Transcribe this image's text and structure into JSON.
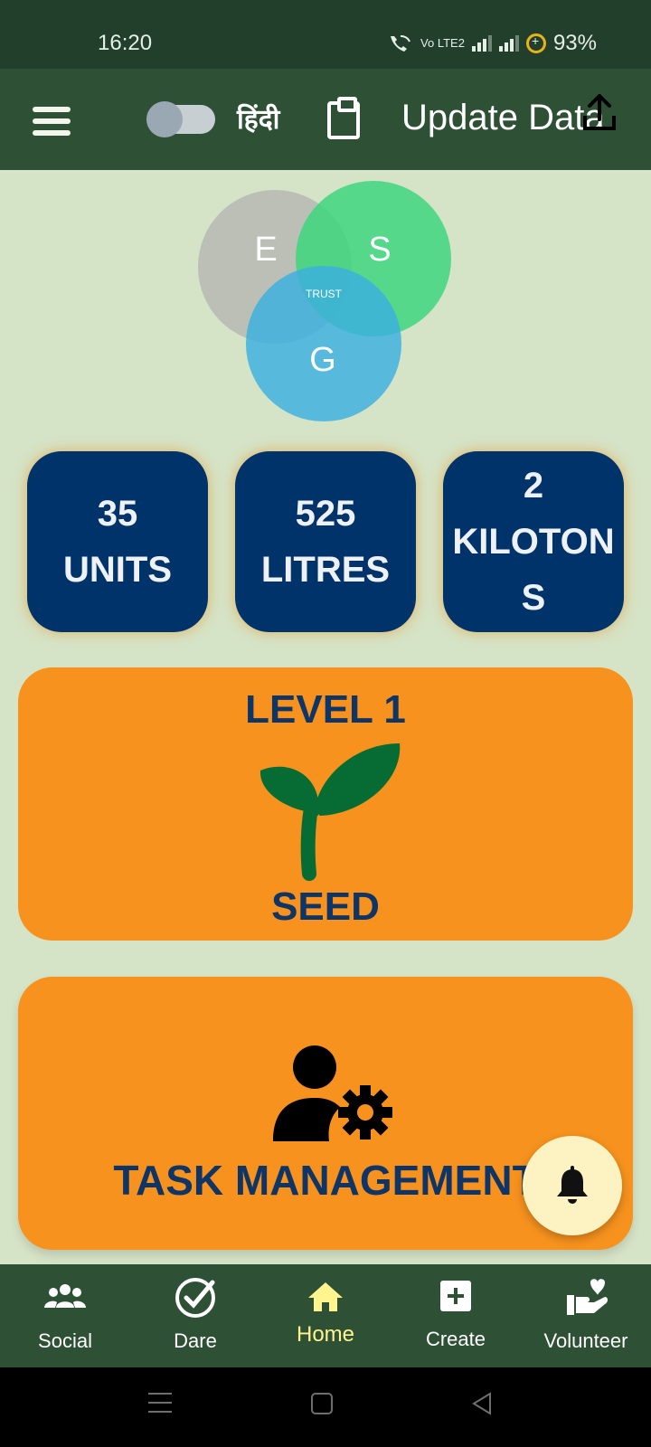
{
  "status_bar": {
    "time": "16:20",
    "volte": "Vo LTE2",
    "battery": "93%"
  },
  "header": {
    "language_label": "हिंदी",
    "language_toggle_on": false,
    "update_label": "Update Data"
  },
  "logo": {
    "letters": [
      "E",
      "S",
      "G"
    ],
    "center_label": "TRUST"
  },
  "stats": [
    {
      "value": "35",
      "unit": "UNITS"
    },
    {
      "value": "525",
      "unit": "LITRES"
    },
    {
      "value": "2",
      "unit": "KILOTON",
      "unit_wrap": "S"
    }
  ],
  "level": {
    "title": "LEVEL 1",
    "icon": "sprout-icon",
    "name": "SEED"
  },
  "task": {
    "icon": "user-gear-icon",
    "title": "TASK MANAGEMENT"
  },
  "nav": [
    {
      "label": "Social",
      "icon": "group-icon",
      "active": false
    },
    {
      "label": "Dare",
      "icon": "check-circle-icon",
      "active": false
    },
    {
      "label": "Home",
      "icon": "home-icon",
      "active": true
    },
    {
      "label": "Create",
      "icon": "plus-square-icon",
      "active": false
    },
    {
      "label": "Volunteer",
      "icon": "hand-heart-icon",
      "active": false
    }
  ],
  "colors": {
    "status_bar": "#223f2c",
    "app_bar": "#2e5035",
    "background": "#d5e3c6",
    "stat_card": "#003369",
    "orange_card": "#f7921e",
    "navy_text": "#0f3566",
    "active_nav": "#fff48e",
    "fab": "#fdf3c2"
  }
}
